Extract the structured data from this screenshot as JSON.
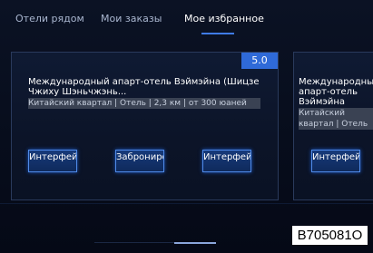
{
  "tabs": [
    {
      "label": "Отели рядом"
    },
    {
      "label": "Мои заказы"
    },
    {
      "label": "Мое избранное"
    }
  ],
  "cards": [
    {
      "rating": "5.0",
      "name": "Международный апарт-отель Вэймэйна (Шицзе Чжиху Шэньчжэнь...",
      "meta": "Китайский квартал | Отель | 2,3 км | от 300 юаней",
      "buttons": [
        "Интерфейс",
        "Забронировать",
        "Интерфейс"
      ]
    },
    {
      "name": "Международный апарт-отель Вэймэйна",
      "meta_a": "Китайский",
      "meta_b": "квартал | Отель",
      "buttons": [
        "Интерфейс"
      ]
    }
  ],
  "code_label": "B705081O",
  "colors": {
    "accent": "#2f6ad8",
    "button_border": "#4f8ae8",
    "background": "#070d1c"
  }
}
